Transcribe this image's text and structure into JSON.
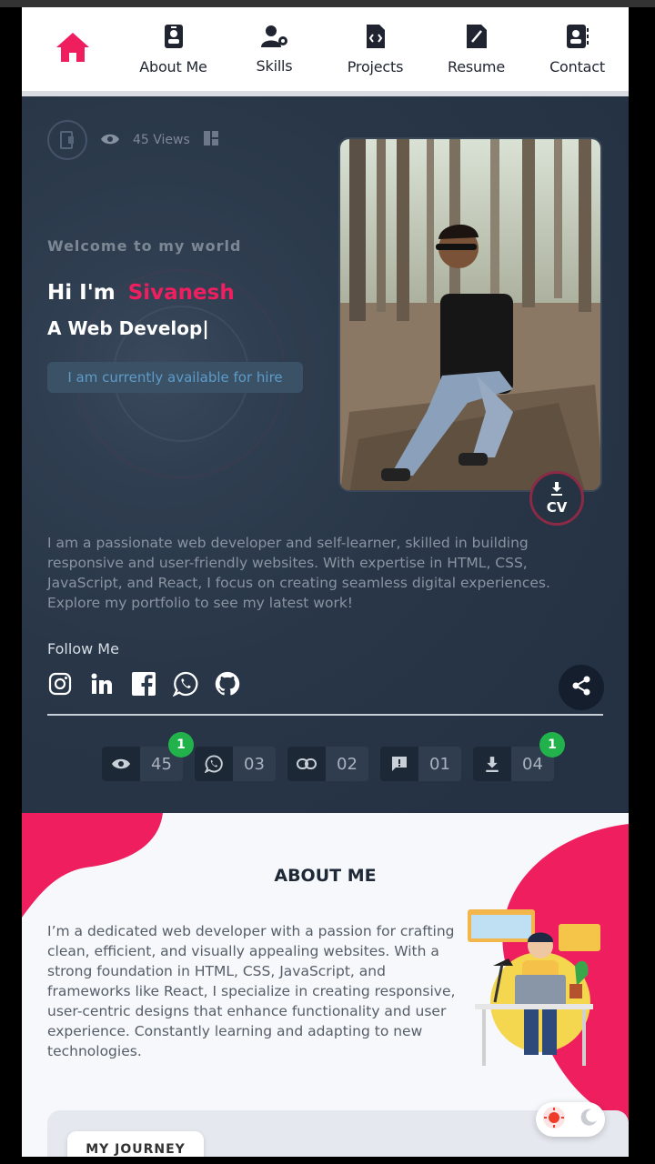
{
  "nav": {
    "home_label": "Home",
    "items": [
      {
        "label": "About Me",
        "icon": "id-badge-icon"
      },
      {
        "label": "Skills",
        "icon": "user-gear-icon"
      },
      {
        "label": "Projects",
        "icon": "code-file-icon"
      },
      {
        "label": "Resume",
        "icon": "resume-file-icon"
      },
      {
        "label": "Contact",
        "icon": "contact-card-icon"
      }
    ],
    "accent": "#ef1f5f"
  },
  "hero": {
    "views_text": "45 Views",
    "welcome": "Welcome to my world",
    "greeting": "Hi I'm",
    "name": "Sivanesh",
    "role_typing": "A Web Develop|",
    "availability": "I am currently available for hire",
    "cv_label": "CV",
    "bio": "I am a passionate web developer and self-learner, skilled in building responsive and user-friendly websites. With expertise in HTML, CSS, JavaScript, and React, I focus on creating seamless digital experiences. Explore my portfolio to see my latest work!",
    "follow_label": "Follow Me",
    "socials": [
      "instagram-icon",
      "linkedin-icon",
      "facebook-icon",
      "whatsapp-icon",
      "github-icon"
    ]
  },
  "counters": [
    {
      "icon": "eye-icon",
      "value": "45",
      "badge": "1"
    },
    {
      "icon": "whatsapp-icon",
      "value": "03",
      "badge": ""
    },
    {
      "icon": "link-icon",
      "value": "02",
      "badge": ""
    },
    {
      "icon": "comment-icon",
      "value": "01",
      "badge": ""
    },
    {
      "icon": "download-icon",
      "value": "04",
      "badge": "1"
    }
  ],
  "about": {
    "title": "ABOUT ME",
    "text": "I’m a dedicated web developer with a passion for crafting clean, efficient, and visually appealing websites. With a strong foundation in HTML, CSS, JavaScript, and frameworks like React, I specialize in creating responsive, user-centric designs that enhance functionality and user experience. Constantly learning and adapting to new technologies.",
    "journey_tab": "MY JOURNEY"
  },
  "theme_toggle": {
    "light_icon": "sun-icon",
    "dark_icon": "moon-icon"
  }
}
